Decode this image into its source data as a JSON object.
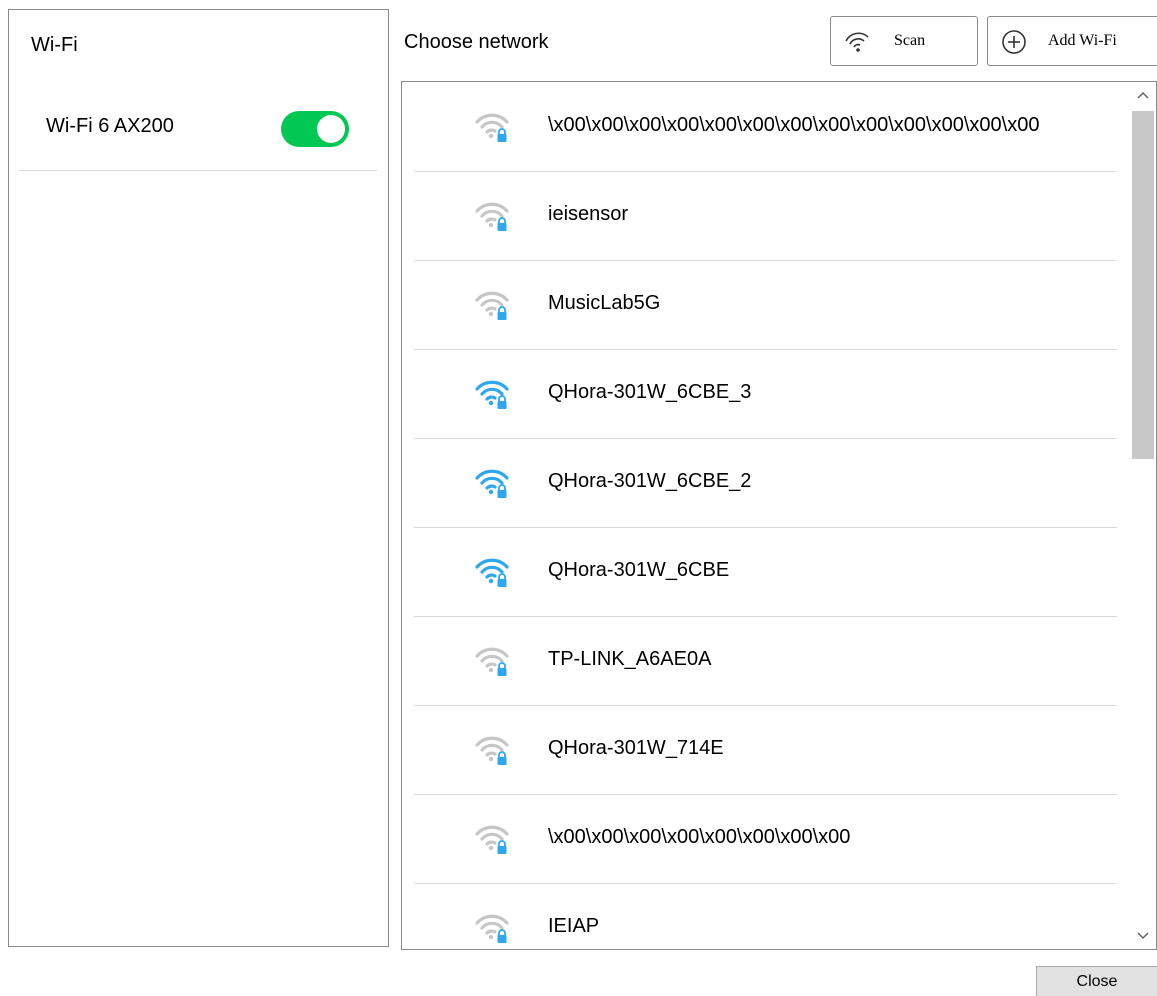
{
  "sidebar": {
    "title": "Wi-Fi",
    "adapter": {
      "name": "Wi-Fi 6 AX200",
      "enabled": true
    }
  },
  "header": {
    "choose_label": "Choose network",
    "scan_label": "Scan",
    "add_label": "Add Wi-Fi"
  },
  "networks": [
    {
      "ssid": "\\x00\\x00\\x00\\x00\\x00\\x00\\x00\\x00\\x00\\x00\\x00\\x00\\x00",
      "signal": "weak",
      "locked": true
    },
    {
      "ssid": "ieisensor",
      "signal": "weak",
      "locked": true
    },
    {
      "ssid": "MusicLab5G",
      "signal": "weak",
      "locked": true
    },
    {
      "ssid": "QHora-301W_6CBE_3",
      "signal": "strong",
      "locked": true
    },
    {
      "ssid": "QHora-301W_6CBE_2",
      "signal": "strong",
      "locked": true
    },
    {
      "ssid": "QHora-301W_6CBE",
      "signal": "strong",
      "locked": true
    },
    {
      "ssid": "TP-LINK_A6AE0A",
      "signal": "weak",
      "locked": true
    },
    {
      "ssid": "QHora-301W_714E",
      "signal": "weak",
      "locked": true
    },
    {
      "ssid": "\\x00\\x00\\x00\\x00\\x00\\x00\\x00\\x00",
      "signal": "weak",
      "locked": true
    },
    {
      "ssid": "IEIAP",
      "signal": "weak",
      "locked": true
    }
  ],
  "footer": {
    "close_label": "Close"
  },
  "colors": {
    "toggle_on": "#00c853",
    "wifi_strong": "#2ea7ee",
    "wifi_weak": "#c6c6c6",
    "lock": "#2ea7ee"
  }
}
